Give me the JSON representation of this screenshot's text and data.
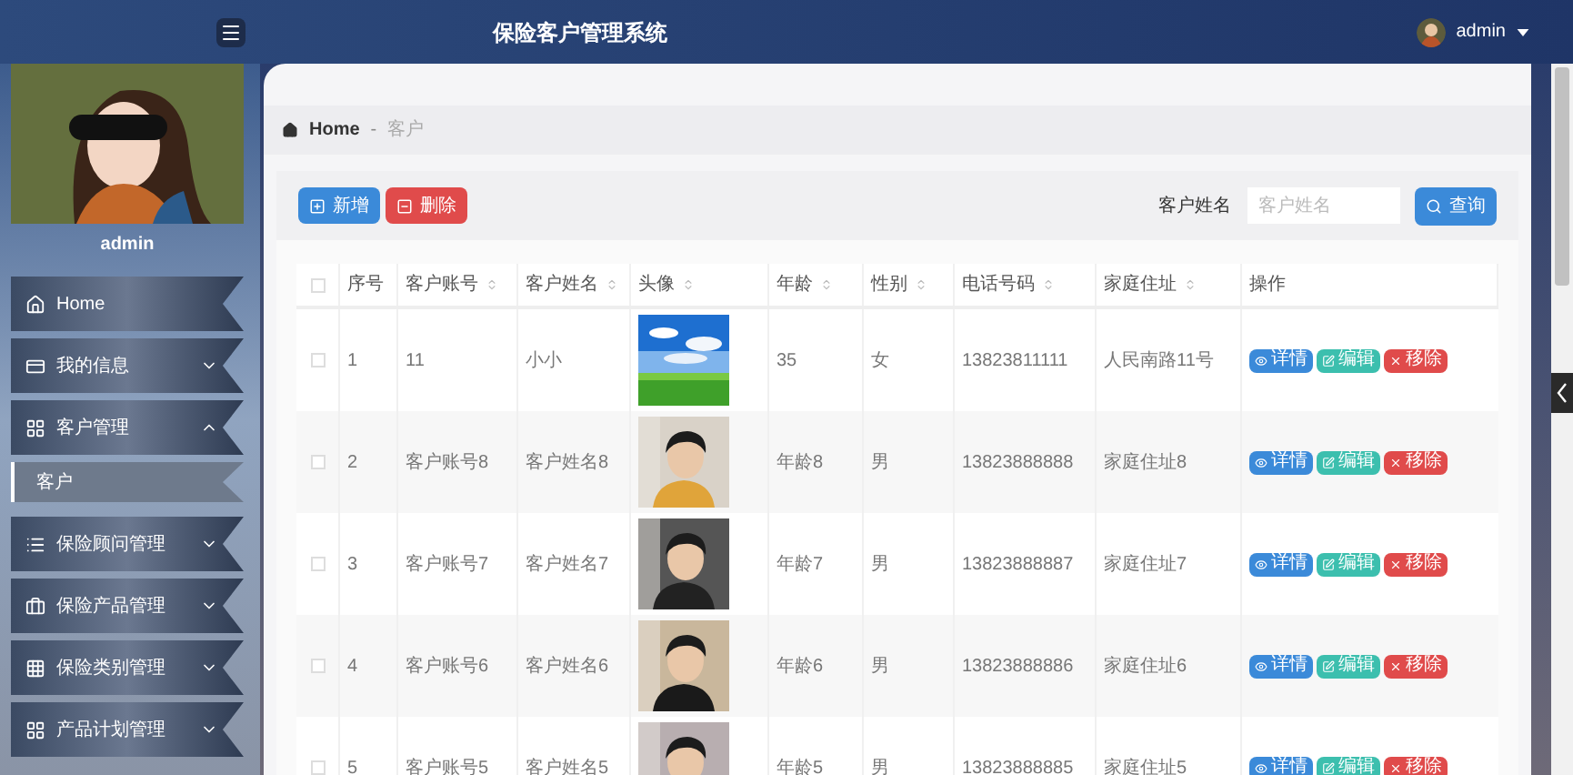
{
  "header": {
    "title": "保险客户管理系统",
    "user": "admin"
  },
  "sidebar": {
    "username": "admin",
    "menu": [
      {
        "label": "Home"
      },
      {
        "label": "我的信息",
        "expanded": false
      },
      {
        "label": "客户管理",
        "expanded": true,
        "children": [
          {
            "label": "客户",
            "selected": true
          }
        ]
      },
      {
        "label": "保险顾问管理",
        "expanded": false
      },
      {
        "label": "保险产品管理",
        "expanded": false
      },
      {
        "label": "保险类别管理",
        "expanded": false
      },
      {
        "label": "产品计划管理",
        "expanded": false
      }
    ]
  },
  "breadcrumb": {
    "items": [
      "Home",
      "客户"
    ],
    "separator": "-"
  },
  "toolbar": {
    "buttons": [
      {
        "kind": "add",
        "label": "新增"
      },
      {
        "kind": "delete",
        "label": "删除"
      }
    ],
    "search_label": "客户姓名",
    "search": {
      "placeholder": "客户姓名"
    },
    "search_button": "查询"
  },
  "table": {
    "select_all_checked": false,
    "columns": [
      {
        "label": "序号",
        "sortable": false
      },
      {
        "label": "客户账号",
        "sortable": true
      },
      {
        "label": "客户姓名",
        "sortable": true
      },
      {
        "label": "头像",
        "sortable": true
      },
      {
        "label": "年龄",
        "sortable": true
      },
      {
        "label": "性别",
        "sortable": true
      },
      {
        "label": "电话号码",
        "sortable": true
      },
      {
        "label": "家庭住址",
        "sortable": true
      },
      {
        "label": "操作",
        "sortable": false
      }
    ],
    "rows": [
      {
        "checked": false,
        "cells": [
          "1",
          "11",
          "小小",
          {
            "kind": "picture"
          },
          "35",
          "女",
          "13823811111",
          "人民南路11号"
        ],
        "actions": [
          {
            "kind": "view",
            "label": "详情"
          },
          {
            "kind": "edit",
            "label": "编辑"
          },
          {
            "kind": "remove",
            "label": "移除"
          }
        ]
      },
      {
        "checked": false,
        "cells": [
          "2",
          "客户账号8",
          "客户姓名8",
          {
            "kind": "picture"
          },
          "年龄8",
          "男",
          "13823888888",
          "家庭住址8"
        ],
        "actions": [
          {
            "kind": "view",
            "label": "详情"
          },
          {
            "kind": "edit",
            "label": "编辑"
          },
          {
            "kind": "remove",
            "label": "移除"
          }
        ]
      },
      {
        "checked": false,
        "cells": [
          "3",
          "客户账号7",
          "客户姓名7",
          {
            "kind": "picture"
          },
          "年龄7",
          "男",
          "13823888887",
          "家庭住址7"
        ],
        "actions": [
          {
            "kind": "view",
            "label": "详情"
          },
          {
            "kind": "edit",
            "label": "编辑"
          },
          {
            "kind": "remove",
            "label": "移除"
          }
        ]
      },
      {
        "checked": false,
        "cells": [
          "4",
          "客户账号6",
          "客户姓名6",
          {
            "kind": "picture"
          },
          "年龄6",
          "男",
          "13823888886",
          "家庭住址6"
        ],
        "actions": [
          {
            "kind": "view",
            "label": "详情"
          },
          {
            "kind": "edit",
            "label": "编辑"
          },
          {
            "kind": "remove",
            "label": "移除"
          }
        ]
      },
      {
        "checked": false,
        "cells": [
          "5",
          "客户账号5",
          "客户姓名5",
          {
            "kind": "picture"
          },
          "年龄5",
          "男",
          "13823888885",
          "家庭住址5"
        ],
        "actions": [
          {
            "kind": "view",
            "label": "详情"
          },
          {
            "kind": "edit",
            "label": "编辑"
          },
          {
            "kind": "remove",
            "label": "移除"
          }
        ]
      }
    ]
  }
}
